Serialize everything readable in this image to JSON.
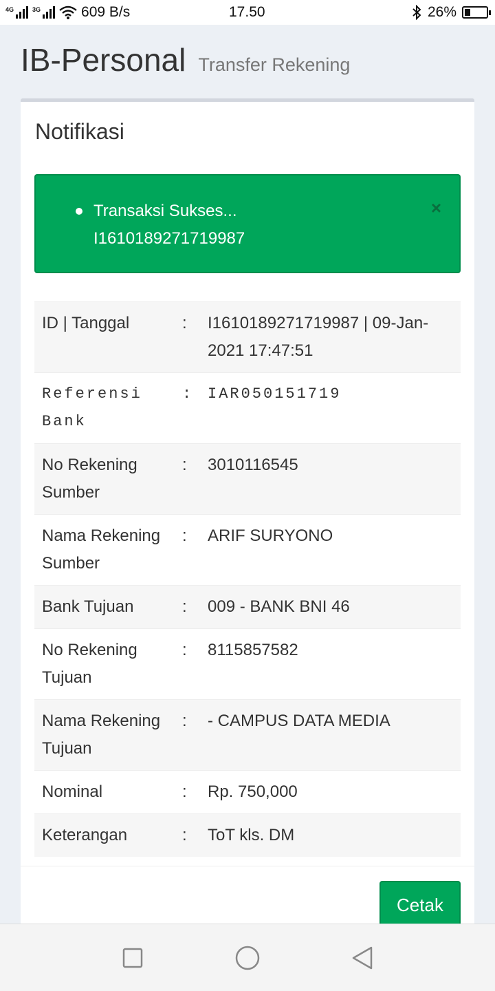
{
  "status_bar": {
    "network_1": "4G",
    "network_2": "3G",
    "speed": "609 B/s",
    "time": "17.50",
    "battery": "26%",
    "battery_level": 0.26,
    "icons": [
      "signal-icon",
      "wifi-icon",
      "bluetooth-icon",
      "battery-icon"
    ]
  },
  "header": {
    "title": "IB-Personal",
    "subtitle": "Transfer Rekening"
  },
  "box": {
    "title": "Notifikasi"
  },
  "alert": {
    "message_line1": "Transaksi Sukses...",
    "message_line2": "I1610189271719987",
    "close_icon": "×"
  },
  "details": {
    "separator": ":",
    "rows": [
      {
        "label": "ID | Tanggal",
        "value": "I1610189271719987 | 09-Jan-2021 17:47:51"
      },
      {
        "label": "Referensi Bank",
        "value": "IAR050151719"
      },
      {
        "label": "No Rekening Sumber",
        "value": "3010116545"
      },
      {
        "label": "Nama Rekening Sumber",
        "value": "ARIF SURYONO"
      },
      {
        "label": "Bank Tujuan",
        "value": "009 - BANK BNI 46"
      },
      {
        "label": "No Rekening Tujuan",
        "value": "8115857582"
      },
      {
        "label": "Nama Rekening Tujuan",
        "value": "- CAMPUS DATA MEDIA"
      },
      {
        "label": "Nominal",
        "value": "Rp. 750,000"
      },
      {
        "label": "Keterangan",
        "value": "ToT kls. DM"
      }
    ]
  },
  "footer": {
    "print_label": "Cetak"
  },
  "colors": {
    "success": "#00a65a",
    "background": "#ecf0f5"
  }
}
